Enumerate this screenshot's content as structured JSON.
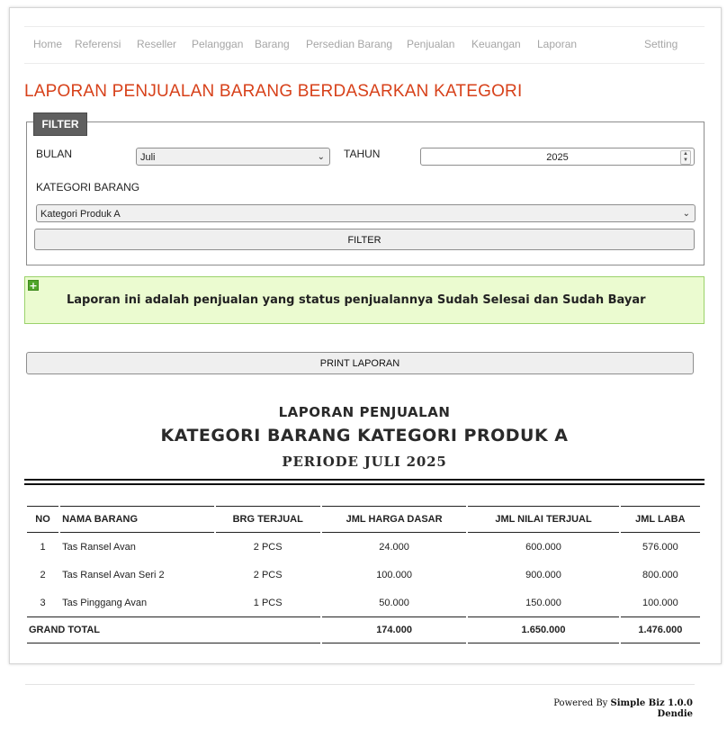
{
  "nav": {
    "items": [
      {
        "label": "Home"
      },
      {
        "label": "Referensi"
      },
      {
        "label": "Reseller"
      },
      {
        "label": "Pelanggan"
      },
      {
        "label": "Barang"
      },
      {
        "label": "Persedian Barang"
      },
      {
        "label": "Penjualan"
      },
      {
        "label": "Keuangan"
      },
      {
        "label": "Laporan"
      },
      {
        "label": "Setting"
      }
    ],
    "text_color": "#a6a6a6"
  },
  "page": {
    "title": "LAPORAN PENJUALAN BARANG BERDASARKAN KATEGORI",
    "title_color": "#d7411a"
  },
  "filter": {
    "legend": "FILTER",
    "bulan_label": "BULAN",
    "bulan_value": "Juli",
    "tahun_label": "TAHUN",
    "tahun_value": "2025",
    "kategori_label": "KATEGORI BARANG",
    "kategori_value": "Kategori Produk A",
    "submit_label": "FILTER"
  },
  "notice": {
    "icon": "plus-icon",
    "text": "Laporan ini adalah penjualan yang status penjualannya Sudah Selesai dan Sudah Bayar",
    "bg_color": "#ebfbd0"
  },
  "print_button": "PRINT LAPORAN",
  "report": {
    "heading": "LAPORAN PENJUALAN",
    "subheading": "KATEGORI BARANG KATEGORI PRODUK A",
    "period": "PERIODE JULI 2025",
    "columns": [
      "NO",
      "NAMA BARANG",
      "BRG TERJUAL",
      "JML HARGA DASAR",
      "JML NILAI TERJUAL",
      "JML LABA"
    ],
    "rows": [
      {
        "no": "1",
        "nama": "Tas Ransel Avan",
        "terjual": "2 PCS",
        "harga_dasar": "24.000",
        "nilai_terjual": "600.000",
        "laba": "576.000"
      },
      {
        "no": "2",
        "nama": "Tas Ransel Avan Seri 2",
        "terjual": "2 PCS",
        "harga_dasar": "100.000",
        "nilai_terjual": "900.000",
        "laba": "800.000"
      },
      {
        "no": "3",
        "nama": "Tas Pinggang Avan",
        "terjual": "1 PCS",
        "harga_dasar": "50.000",
        "nilai_terjual": "150.000",
        "laba": "100.000"
      }
    ],
    "total": {
      "label": "GRAND TOTAL",
      "harga_dasar": "174.000",
      "nilai_terjual": "1.650.000",
      "laba": "1.476.000"
    }
  },
  "footer": {
    "powered_prefix": "Powered By",
    "product": "Simple Biz 1.0.0",
    "author": "Dendie"
  }
}
